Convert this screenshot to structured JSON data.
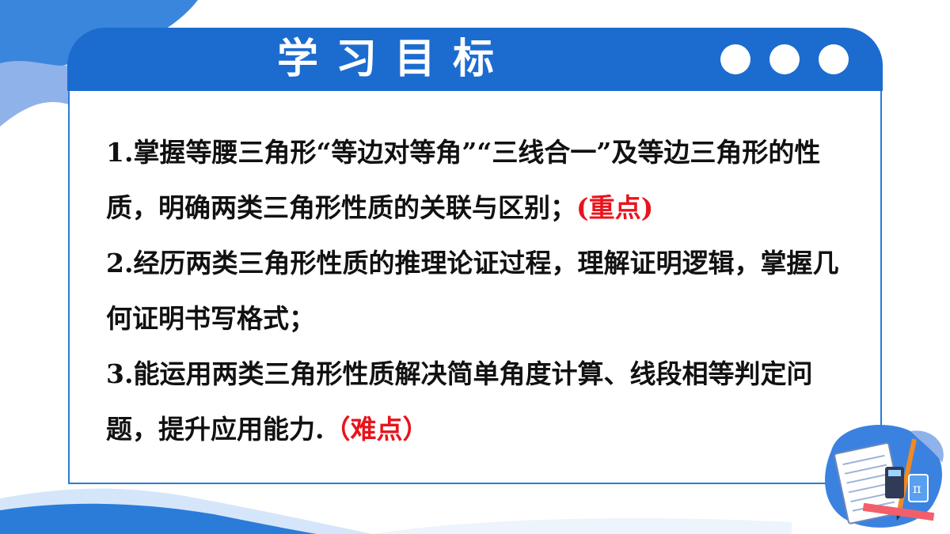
{
  "header": {
    "title": "学习目标",
    "dots_count": 3
  },
  "objectives": [
    {
      "text": "1.掌握等腰三角形“等边对等角”“三线合一”及等边三角形的性质，明确两类三角形性质的关联与区别；",
      "tag": "(重点)"
    },
    {
      "text": "2.经历两类三角形性质的推理论证过程，理解证明逻辑，掌握几何证明书写格式；",
      "tag": ""
    },
    {
      "text": "3.能运用两类三角形性质解决简单角度计算、线段相等判定问题，提升应用能力.",
      "tag": "（难点）"
    }
  ],
  "colors": {
    "header_blue": "#1c6cd0",
    "accent_red": "#e8141c",
    "light_blue": "#8fb6ee"
  },
  "decor_icon": "math-stationery-illustration"
}
